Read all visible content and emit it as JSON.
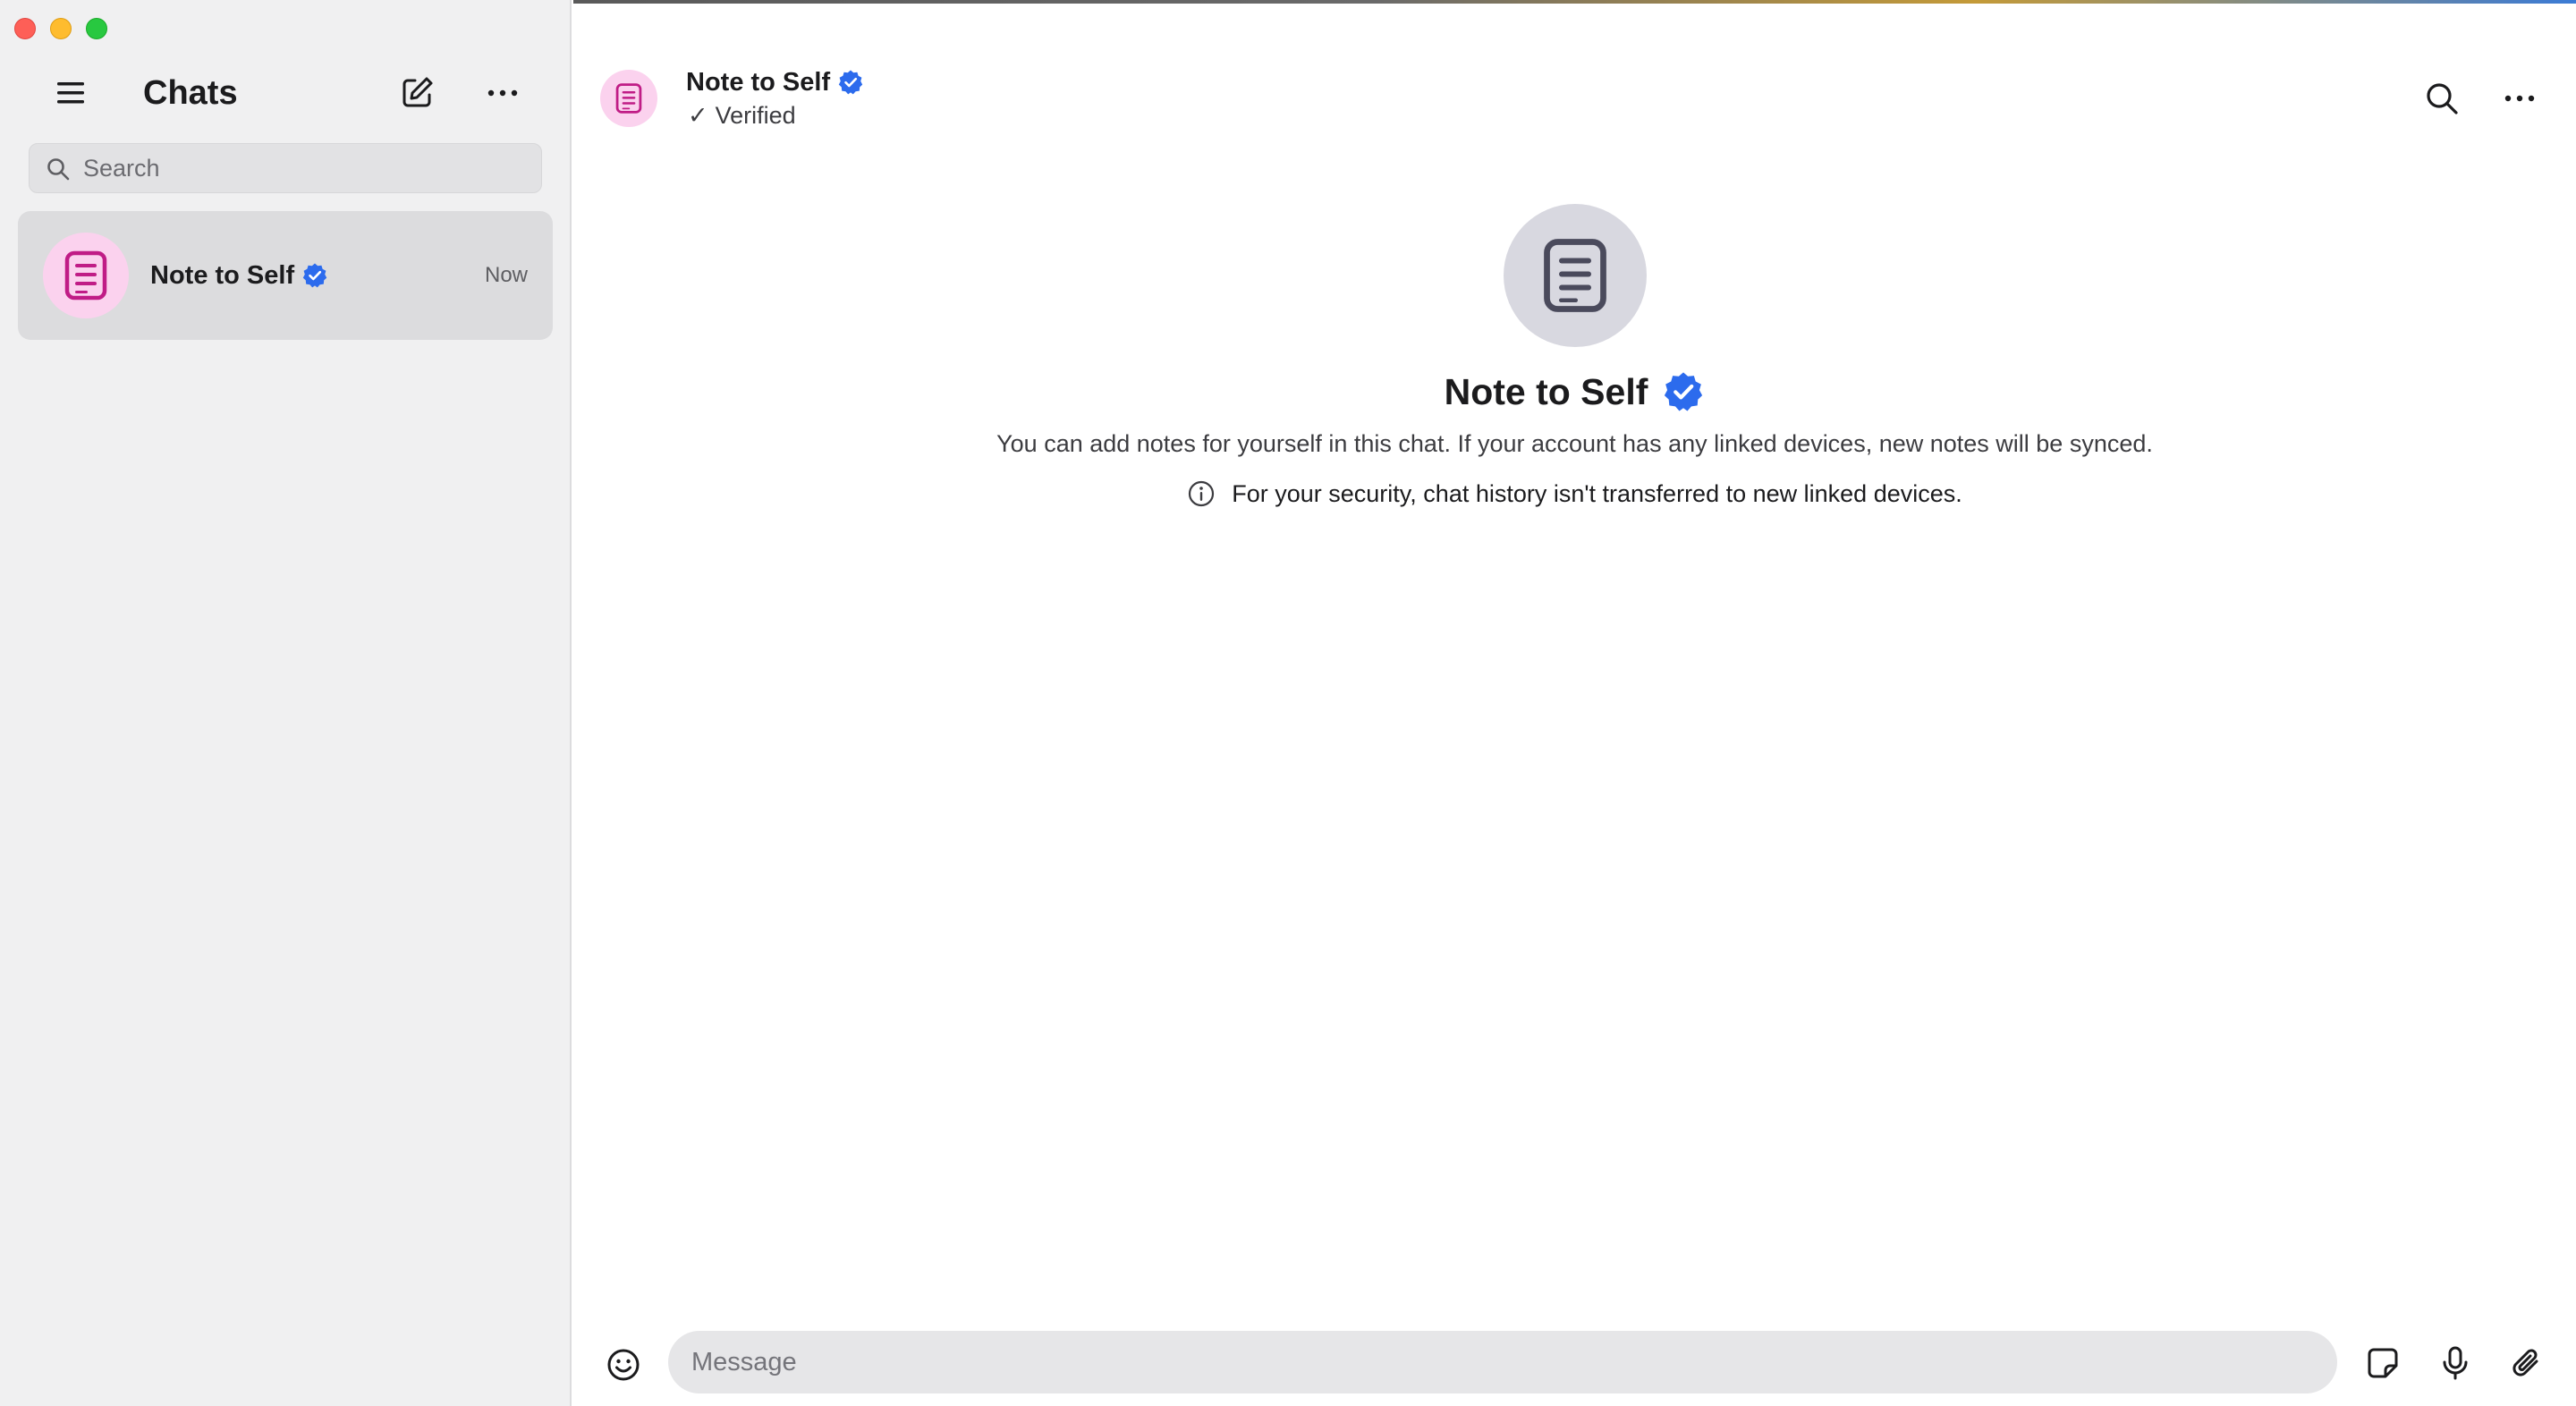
{
  "colors": {
    "accent_blue": "#2c6bed",
    "avatar_pink_bg": "#fbd2ee",
    "avatar_pink_icon": "#c01c86",
    "intro_avatar_bg": "#d8d8e0",
    "intro_avatar_icon": "#4a4a5c",
    "sidebar_bg": "#f0f0f1",
    "selected_item_bg": "#dcdcde"
  },
  "sidebar": {
    "title": "Chats",
    "search": {
      "placeholder": "Search",
      "value": ""
    },
    "chats": [
      {
        "name": "Note to Self",
        "time": "Now",
        "verified": true,
        "icon": "note-icon"
      }
    ]
  },
  "conversation": {
    "header": {
      "title": "Note to Self",
      "subtitle_check": "✓",
      "subtitle": "Verified"
    },
    "intro": {
      "title": "Note to Self",
      "description": "You can add notes for yourself in this chat. If your account has any linked devices, new notes will be synced.",
      "security_note": "For your security, chat history isn't transferred to new linked devices."
    },
    "composer": {
      "placeholder": "Message",
      "value": ""
    }
  },
  "icons": {
    "menu": "hamburger-icon",
    "compose": "compose-icon",
    "more": "more-horizontal-icon",
    "search": "search-icon",
    "verified": "verified-badge-icon",
    "info": "info-icon",
    "emoji": "emoji-icon",
    "sticker": "sticker-icon",
    "mic": "microphone-icon",
    "attach": "paperclip-icon"
  }
}
